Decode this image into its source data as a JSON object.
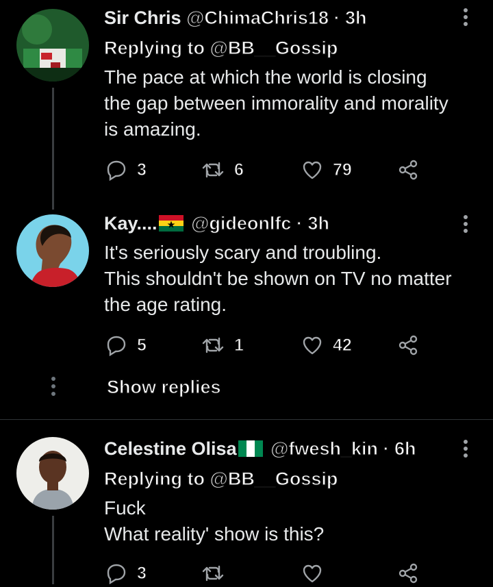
{
  "tweets": [
    {
      "name": "Sir Chris",
      "handle": "@ChimaChris18",
      "sep": "·",
      "time": "3h",
      "replying_label": "Replying to",
      "replying_handle": "@BB__Gossip",
      "lines": [
        "The pace at which the world is closing",
        "the gap between immorality and morality",
        "is amazing."
      ],
      "replies": "3",
      "retweets": "6",
      "likes": "79"
    },
    {
      "name": "Kay....",
      "flag": "ghana-flag",
      "handle": "@gideonlfc",
      "sep": "·",
      "time": "3h",
      "lines": [
        "It's seriously scary and troubling.",
        "This shouldn't be shown on TV no matter",
        "the age rating."
      ],
      "replies": "5",
      "retweets": "1",
      "likes": "42"
    },
    {
      "name": "Celestine Olisa",
      "flag": "nigeria-flag",
      "handle": "@fwesh_kin",
      "sep": "·",
      "time": "6h",
      "replying_label": "Replying to",
      "replying_handle": "@BB__Gossip",
      "lines": [
        "Fuck",
        "What reality' show is this?"
      ],
      "replies": "3",
      "retweets": "",
      "likes": ""
    }
  ],
  "show_replies": "Show replies",
  "colors": {
    "background": "#000000",
    "text": "#e7e9ea",
    "icon": "#a0a4a8",
    "divider": "#2f3336"
  }
}
